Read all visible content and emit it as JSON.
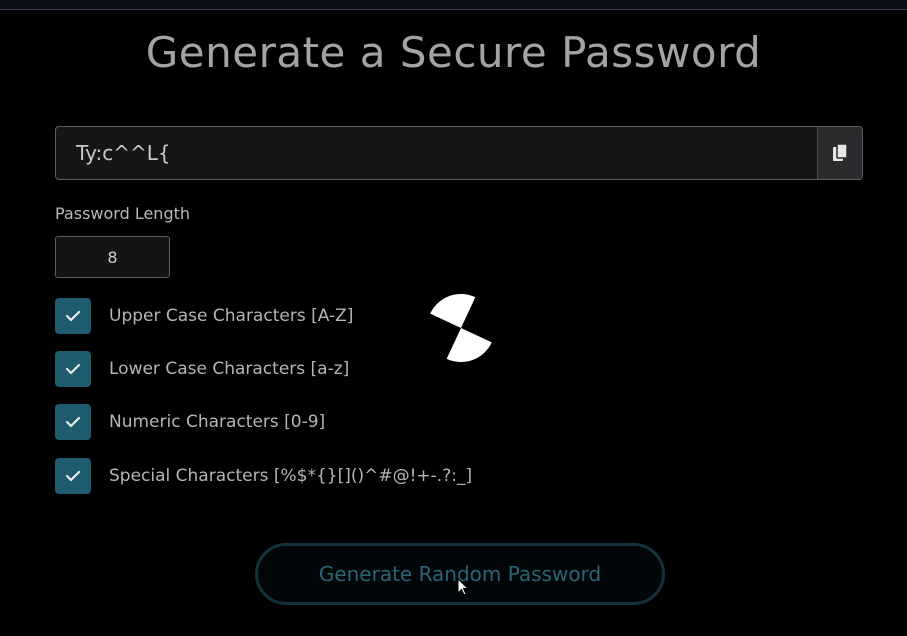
{
  "page": {
    "title": "Generate a Secure Password"
  },
  "password": {
    "value": "Ty:c^^L{",
    "copy_icon": "copy-icon"
  },
  "length": {
    "label": "Password Length",
    "value": "8"
  },
  "options": [
    {
      "label": "Upper Case Characters [A-Z]",
      "checked": true
    },
    {
      "label": "Lower Case Characters [a-z]",
      "checked": true
    },
    {
      "label": "Numeric Characters [0-9]",
      "checked": true
    },
    {
      "label": "Special Characters [%$*{}[]()^#@!+-.?:_]",
      "checked": true
    }
  ],
  "generate_button": {
    "label": "Generate Random Password"
  },
  "colors": {
    "background": "#000000",
    "checkbox": "#1f5b6e",
    "button_text": "#2c6477",
    "title": "#a3a3a3"
  }
}
